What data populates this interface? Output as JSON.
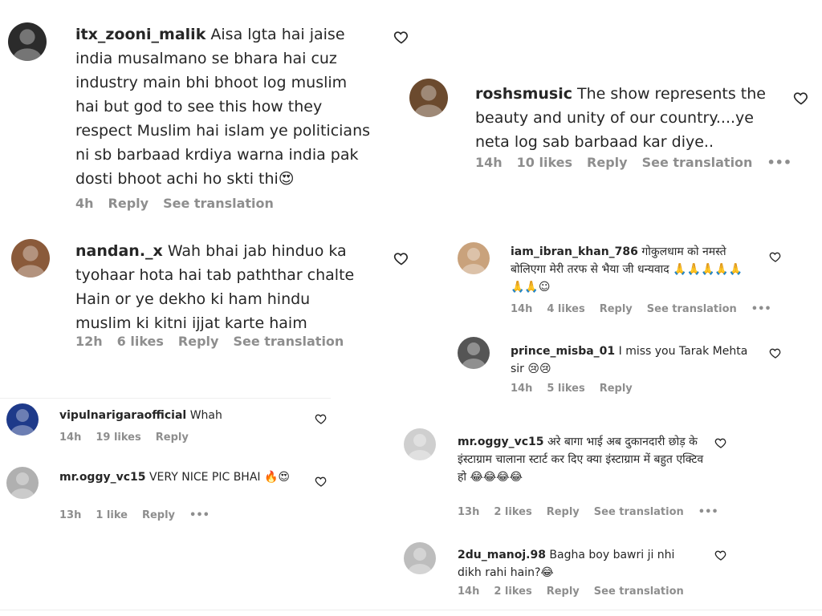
{
  "comments": [
    {
      "username": "itx_zooni_malik",
      "text": "Aisa lgta hai jaise india musalmano se bhara hai cuz industry main bhi bhoot log muslim hai but god to see this how they respect Muslim hai islam ye politicians ni sb barbaad krdiya warna india pak dosti bhoot achi ho skti thi😍",
      "meta": {
        "time": "4h",
        "likes": "",
        "reply": "Reply",
        "translation": "See translation",
        "more": ""
      }
    },
    {
      "username": "nandan._x",
      "text": "Wah bhai jab hinduo ka tyohaar hota hai tab paththar chalte Hain or ye dekho ki ham hindu muslim ki kitni ijjat karte haim",
      "meta": {
        "time": "12h",
        "likes": "6 likes",
        "reply": "Reply",
        "translation": "See translation",
        "more": ""
      }
    },
    {
      "username": "vipulnarigaraofficial",
      "text": "Whah",
      "meta": {
        "time": "14h",
        "likes": "19 likes",
        "reply": "Reply",
        "translation": "",
        "more": ""
      }
    },
    {
      "username": "mr.oggy_vc15",
      "text": "VERY NICE PIC BHAI 🔥😍",
      "meta": {
        "time": "13h",
        "likes": "1 like",
        "reply": "Reply",
        "translation": "",
        "more": "•••"
      }
    },
    {
      "username": "roshsmusic",
      "text": "The show represents the beauty and unity of our country....ye neta log sab barbaad kar diye..",
      "meta": {
        "time": "14h",
        "likes": "10 likes",
        "reply": "Reply",
        "translation": "See translation",
        "more": "•••"
      }
    },
    {
      "username": "iam_ibran_khan_786",
      "text": "गोकुलधाम को नमस्ते बोलिएगा मेरी तरफ से भैया जी धन्यवाद 🙏🙏🙏🙏🙏🙏🙏☺",
      "meta": {
        "time": "14h",
        "likes": "4 likes",
        "reply": "Reply",
        "translation": "See translation",
        "more": "•••"
      }
    },
    {
      "username": "prince_misba_01",
      "text": "I miss you Tarak Mehta sir 😢😢",
      "meta": {
        "time": "14h",
        "likes": "5 likes",
        "reply": "Reply",
        "translation": "",
        "more": ""
      }
    },
    {
      "username": "mr.oggy_vc15",
      "text": "अरे बागा भाई अब दुकानदारी छोड़ के इंस्टाग्राम चालाना स्टार्ट कर दिए क्या इंस्टाग्राम में बहुत एक्टिव हो 😂😂😂😂",
      "meta": {
        "time": "13h",
        "likes": "2 likes",
        "reply": "Reply",
        "translation": "See translation",
        "more": "•••"
      }
    },
    {
      "username": "2du_manoj.98",
      "text": "Bagha boy bawri ji nhi dikh rahi hain?😂",
      "meta": {
        "time": "14h",
        "likes": "2 likes",
        "reply": "Reply",
        "translation": "See translation",
        "more": ""
      }
    }
  ],
  "icons": {
    "heart": "heart-icon",
    "avatar": "avatar"
  }
}
